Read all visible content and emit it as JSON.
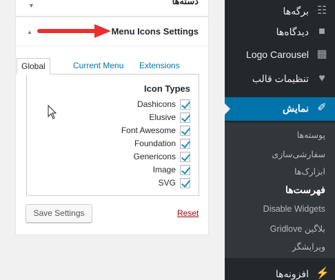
{
  "widget": {
    "partial_title": "دسته‌ها",
    "title": "Menu Icons Settings"
  },
  "tabs": [
    {
      "label": "Global"
    },
    {
      "label": "Current Menu"
    },
    {
      "label": "Extensions"
    }
  ],
  "icon_types": {
    "heading": "Icon Types",
    "options": [
      {
        "label": "Dashicons",
        "checked": true
      },
      {
        "label": "Elusive",
        "checked": true
      },
      {
        "label": "Font Awesome",
        "checked": true
      },
      {
        "label": "Foundation",
        "checked": true
      },
      {
        "label": "Genericons",
        "checked": true
      },
      {
        "label": "Image",
        "checked": true
      },
      {
        "label": "SVG",
        "checked": true
      }
    ]
  },
  "actions": {
    "save": "Save Settings",
    "reset": "Reset"
  },
  "sidebar": {
    "items": [
      {
        "label": "برگه‌ها",
        "icon": "pages-icon"
      },
      {
        "label": "دیدگاه‌ها",
        "icon": "comments-icon"
      },
      {
        "label": "Logo Carousel",
        "icon": "gallery-icon"
      },
      {
        "label": "تنظیمات قالب",
        "icon": "heart-icon"
      },
      {
        "label": "نمایش",
        "icon": "appearance-brush-icon",
        "current": true
      }
    ],
    "submenu": [
      {
        "label": "پوسته‌ها"
      },
      {
        "label": "سفارشی‌سازی"
      },
      {
        "label": "ابزارک‌ها"
      },
      {
        "label": "فهرست‌ها",
        "current": true
      },
      {
        "label": "Disable Widgets"
      },
      {
        "label": "Gridlove بلاگین"
      },
      {
        "label": "ویرایشگر"
      }
    ],
    "bottom": {
      "label": "افزونه‌ها",
      "icon": "plugins-icon"
    }
  },
  "colors": {
    "accent": "#0073aa",
    "sidebar_bg": "#23282d",
    "submenu_bg": "#32373c",
    "reset": "#aa0000",
    "checkmark": "#1e8cbe",
    "annotation_arrow": "#e8312f"
  }
}
